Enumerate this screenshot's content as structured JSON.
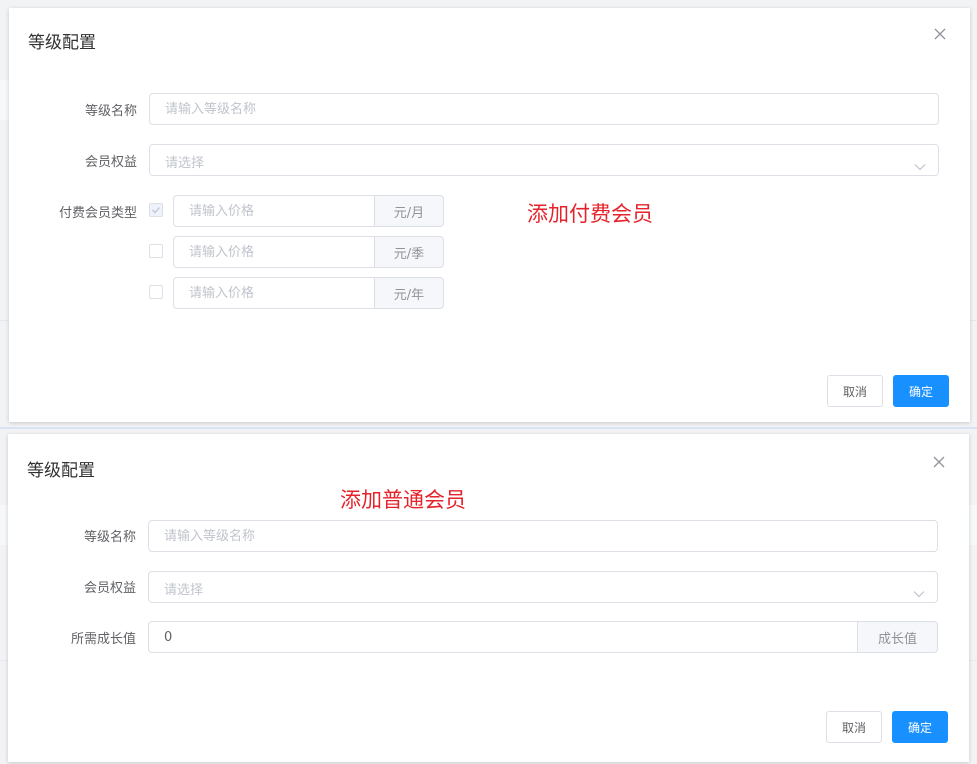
{
  "paid_dialog": {
    "title": "等级配置",
    "annotation": "添加付费会员",
    "level_name": {
      "label": "等级名称",
      "placeholder": "请输入等级名称"
    },
    "benefits": {
      "label": "会员权益",
      "placeholder": "请选择"
    },
    "paid_type_label": "付费会员类型",
    "price_rows": [
      {
        "checked": true,
        "placeholder": "请输入价格",
        "unit": "元/月"
      },
      {
        "checked": false,
        "placeholder": "请输入价格",
        "unit": "元/季"
      },
      {
        "checked": false,
        "placeholder": "请输入价格",
        "unit": "元/年"
      }
    ],
    "cancel_label": "取消",
    "confirm_label": "确定"
  },
  "normal_dialog": {
    "title": "等级配置",
    "annotation": "添加普通会员",
    "level_name": {
      "label": "等级名称",
      "placeholder": "请输入等级名称"
    },
    "benefits": {
      "label": "会员权益",
      "placeholder": "请选择"
    },
    "growth": {
      "label": "所需成长值",
      "value": "0",
      "unit": "成长值"
    },
    "cancel_label": "取消",
    "confirm_label": "确定"
  },
  "colors": {
    "primary": "#1890ff",
    "annotation": "#e5232b"
  }
}
